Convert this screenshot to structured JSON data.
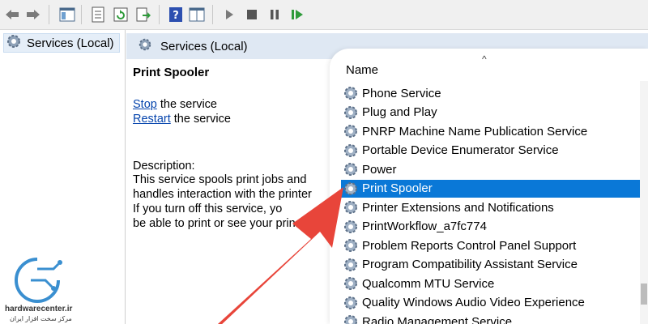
{
  "tree": {
    "item_label": "Services (Local)"
  },
  "header": {
    "title": "Services (Local)"
  },
  "details": {
    "service_title": "Print Spooler",
    "stop_link": "Stop",
    "stop_suffix": " the service",
    "restart_link": "Restart",
    "restart_suffix": " the service",
    "description_label": "Description:",
    "description_lines": [
      "This service spools print jobs and",
      "handles interaction with the printer",
      "If you turn off this service, yo",
      "be able to print or see your prin"
    ]
  },
  "list": {
    "column_name": "Name",
    "sort_indicator": "^",
    "selected_index": 5,
    "services": [
      "Phone Service",
      "Plug and Play",
      "PNRP Machine Name Publication Service",
      "Portable Device Enumerator Service",
      "Power",
      "Print Spooler",
      "Printer Extensions and Notifications",
      "PrintWorkflow_a7fc774",
      "Problem Reports Control Panel Support",
      "Program Compatibility Assistant Service",
      "Qualcomm MTU Service",
      "Quality Windows Audio Video Experience",
      "Radio Management Service"
    ]
  },
  "watermark": {
    "site": "hardwarecenter.ir",
    "tagline": "مرکز سخت افزار ایران"
  },
  "colors": {
    "selection": "#0a78d7",
    "arrow": "#e8453a",
    "header_bg": "#dfe8f3",
    "link": "#0645ad"
  }
}
